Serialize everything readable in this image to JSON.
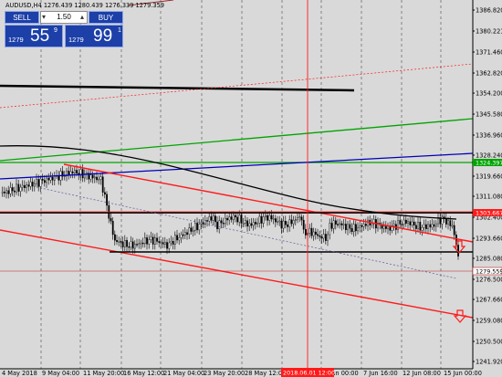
{
  "chart": {
    "symbol_info": "AUDUSD,H4  1276.439 1280.439 1276.339 1279.359",
    "price_axis": [
      "1386.820",
      "1380.221",
      "1371.460",
      "1362.820",
      "1354.200",
      "1345.580",
      "1336.960",
      "1328.240",
      "1319.660",
      "1311.080",
      "1302.400",
      "1293.660",
      "1285.080",
      "1276.500",
      "1267.660",
      "1259.080",
      "1250.500",
      "1241.920"
    ],
    "time_axis": [
      "4 May 2018",
      "9 May 04:00",
      "11 May 20:00",
      "16 May 12:00",
      "21 May 04:00",
      "23 May 20:00",
      "28 May 12:00",
      "2018.06.01 12:00",
      "5 Jun 00:00",
      "7 Jun 16:00",
      "12 Jun 08:00",
      "15 Jun 00:00"
    ],
    "price_tags": {
      "green": "1324.397",
      "red": "1303.667",
      "current": "1279.559"
    },
    "colors": {
      "background": "#d9d9d9",
      "red": "#ff1a1a",
      "green": "#00a400",
      "blue": "#0000b8",
      "black": "#000000",
      "panel": "#1c3fa8"
    }
  },
  "trade": {
    "sell_label": "SELL",
    "buy_label": "BUY",
    "lot": "1.50",
    "lot_minus": "▾",
    "lot_plus": "▴",
    "sell_small": "1279",
    "sell_big": "55",
    "sell_sup": "9",
    "buy_small": "1279",
    "buy_big": "99",
    "buy_sup": "1"
  }
}
